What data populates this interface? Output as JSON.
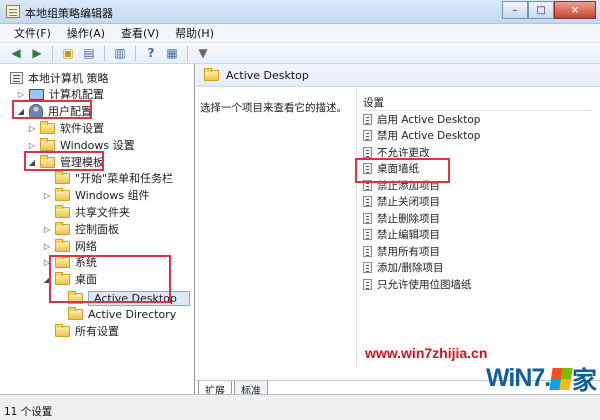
{
  "window": {
    "title": "本地组策略编辑器",
    "controls": [
      "–",
      "□",
      "×"
    ]
  },
  "menu": [
    "文件(F)",
    "操作(A)",
    "查看(V)",
    "帮助(H)"
  ],
  "toolbar": {
    "icons": [
      "back-icon",
      "forward-icon",
      "up-folder-icon",
      "show-hide-tree-icon",
      "export-icon",
      "help-icon",
      "properties-icon",
      "filter-icon"
    ]
  },
  "tree": {
    "items": [
      {
        "label": "本地计算机 策略",
        "expander": ""
      },
      {
        "label": "计算机配置",
        "expander": "▷"
      },
      {
        "label": "用户配置",
        "expander": "◢"
      },
      {
        "label": "软件设置",
        "expander": "▷"
      },
      {
        "label": "Windows 设置",
        "expander": "▷"
      },
      {
        "label": "管理模板",
        "expander": "◢"
      },
      {
        "label": "\"开始\"菜单和任务栏",
        "expander": ""
      },
      {
        "label": "Windows 组件",
        "expander": "▷"
      },
      {
        "label": "共享文件夹",
        "expander": ""
      },
      {
        "label": "控制面板",
        "expander": "▷"
      },
      {
        "label": "网络",
        "expander": "▷"
      },
      {
        "label": "系统",
        "expander": "▷"
      },
      {
        "label": "桌面",
        "expander": "◢"
      },
      {
        "label": "Active Desktop",
        "expander": ""
      },
      {
        "label": "Active Directory",
        "expander": ""
      },
      {
        "label": "所有设置",
        "expander": ""
      }
    ]
  },
  "content": {
    "header": "Active Desktop",
    "description": "选择一个项目来查看它的描述。",
    "settings_header": "设置",
    "settings": [
      "启用 Active Desktop",
      "禁用 Active Desktop",
      "不允许更改",
      "桌面墙纸",
      "禁止添加项目",
      "禁止关闭项目",
      "禁止删除项目",
      "禁止编辑项目",
      "禁用所有项目",
      "添加/删除项目",
      "只允许使用位图墙纸"
    ],
    "tabs": [
      "扩展",
      "标准"
    ]
  },
  "status": "11 个设置",
  "watermark": {
    "url": "www.win7zhijia.cn",
    "logo_text_left": "WiN7.",
    "logo_text_right": "家"
  },
  "colors": {
    "highlight_box": "#df3345",
    "watermark_red": "#d0141c",
    "logo_blue": "#0f5f9a"
  }
}
